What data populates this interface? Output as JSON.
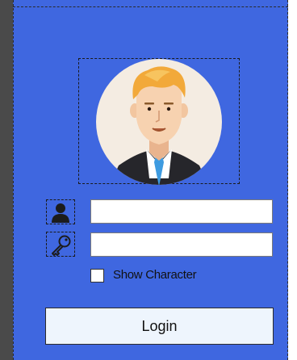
{
  "login_form": {
    "username_value": "",
    "password_value": "",
    "show_character_label": "Show Character",
    "show_character_checked": false,
    "login_label": "Login"
  },
  "icons": {
    "avatar": "avatar-icon",
    "user": "user-icon",
    "key": "key-icon"
  },
  "colors": {
    "panel_background": "#3f67e0",
    "button_background": "#eef5fd"
  }
}
